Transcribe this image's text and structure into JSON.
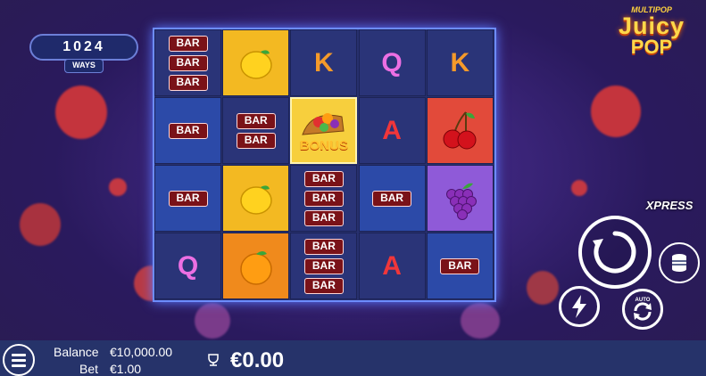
{
  "ways": {
    "count": "1024",
    "label": "WAYS"
  },
  "logo": {
    "line1": "MULTIPOP",
    "line2": "Juicy",
    "line3": "POP"
  },
  "grid": {
    "cells": [
      {
        "kind": "bar",
        "bars": [
          "BAR",
          "BAR",
          "BAR"
        ],
        "bg": "dark"
      },
      {
        "kind": "fruit",
        "fruit": "lemon-icon",
        "bg": "yellow"
      },
      {
        "kind": "letter",
        "text": "K",
        "bg": "dark"
      },
      {
        "kind": "letter",
        "text": "Q",
        "bg": "dark"
      },
      {
        "kind": "letter",
        "text": "K",
        "bg": "dark"
      },
      {
        "kind": "bar",
        "bars": [
          "BAR"
        ],
        "bg": "blue"
      },
      {
        "kind": "bar",
        "bars": [
          "BAR",
          "BAR"
        ],
        "bg": "dark"
      },
      {
        "kind": "bonus",
        "text": "BONUS",
        "bg": "bonus"
      },
      {
        "kind": "letter",
        "text": "A",
        "bg": "dark"
      },
      {
        "kind": "fruit",
        "fruit": "cherry-icon",
        "bg": "red"
      },
      {
        "kind": "bar",
        "bars": [
          "BAR"
        ],
        "bg": "blue"
      },
      {
        "kind": "fruit",
        "fruit": "lemon-icon",
        "bg": "yellow"
      },
      {
        "kind": "bar",
        "bars": [
          "BAR",
          "BAR",
          "BAR"
        ],
        "bg": "dark"
      },
      {
        "kind": "bar",
        "bars": [
          "BAR"
        ],
        "bg": "blue"
      },
      {
        "kind": "fruit",
        "fruit": "grape-icon",
        "bg": "purple"
      },
      {
        "kind": "letter",
        "text": "Q",
        "bg": "dark"
      },
      {
        "kind": "fruit",
        "fruit": "orange-icon",
        "bg": "orange"
      },
      {
        "kind": "bar",
        "bars": [
          "BAR",
          "BAR",
          "BAR"
        ],
        "bg": "dark"
      },
      {
        "kind": "letter",
        "text": "A",
        "bg": "dark"
      },
      {
        "kind": "bar",
        "bars": [
          "BAR"
        ],
        "bg": "blue"
      }
    ]
  },
  "controls": {
    "xpress_label": "XPRESS",
    "auto_label": "AUTO"
  },
  "footer": {
    "balance_label": "Balance",
    "balance_value": "€10,000.00",
    "bet_label": "Bet",
    "bet_value": "€1.00",
    "win_value": "€0.00"
  }
}
